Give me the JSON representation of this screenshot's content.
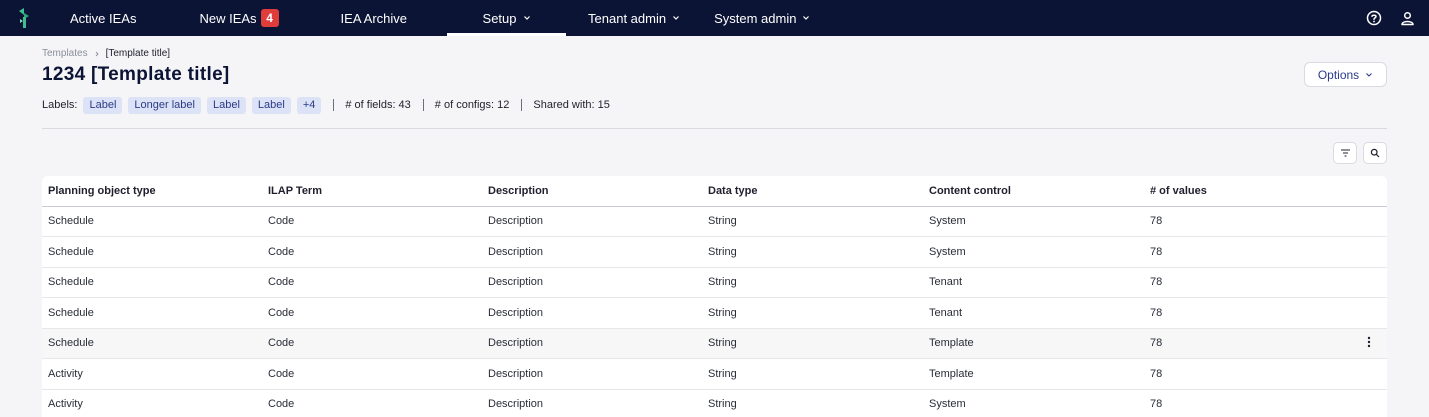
{
  "nav": {
    "items": [
      {
        "label": "Active IEAs"
      },
      {
        "label": "New IEAs",
        "badge": "4"
      },
      {
        "label": "IEA Archive"
      },
      {
        "label": "Setup"
      },
      {
        "label": "Tenant admin"
      },
      {
        "label": "System admin"
      }
    ]
  },
  "breadcrumb": {
    "root": "Templates",
    "current": "[Template title]"
  },
  "title": "1234 [Template title]",
  "options_label": "Options",
  "meta": {
    "labels_caption": "Labels:",
    "chips": [
      "Label",
      "Longer label",
      "Label",
      "Label",
      "+4"
    ],
    "fields": "# of fields: 43",
    "configs": "# of configs: 12",
    "shared": "Shared with: 15"
  },
  "table": {
    "headers": [
      "Planning object type",
      "ILAP Term",
      "Description",
      "Data type",
      "Content control",
      "# of values"
    ],
    "rows": [
      [
        "Schedule",
        "Code",
        "Description",
        "String",
        "System",
        "78"
      ],
      [
        "Schedule",
        "Code",
        "Description",
        "String",
        "System",
        "78"
      ],
      [
        "Schedule",
        "Code",
        "Description",
        "String",
        "Tenant",
        "78"
      ],
      [
        "Schedule",
        "Code",
        "Description",
        "String",
        "Tenant",
        "78"
      ],
      [
        "Schedule",
        "Code",
        "Description",
        "String",
        "Template",
        "78"
      ],
      [
        "Activity",
        "Code",
        "Description",
        "String",
        "Template",
        "78"
      ],
      [
        "Activity",
        "Code",
        "Description",
        "String",
        "System",
        "78"
      ]
    ]
  },
  "colors": {
    "nav_bg": "#0c1436",
    "badge": "#e03c3c",
    "chip_bg": "#dde3f6",
    "accent": "#2a3b88"
  }
}
